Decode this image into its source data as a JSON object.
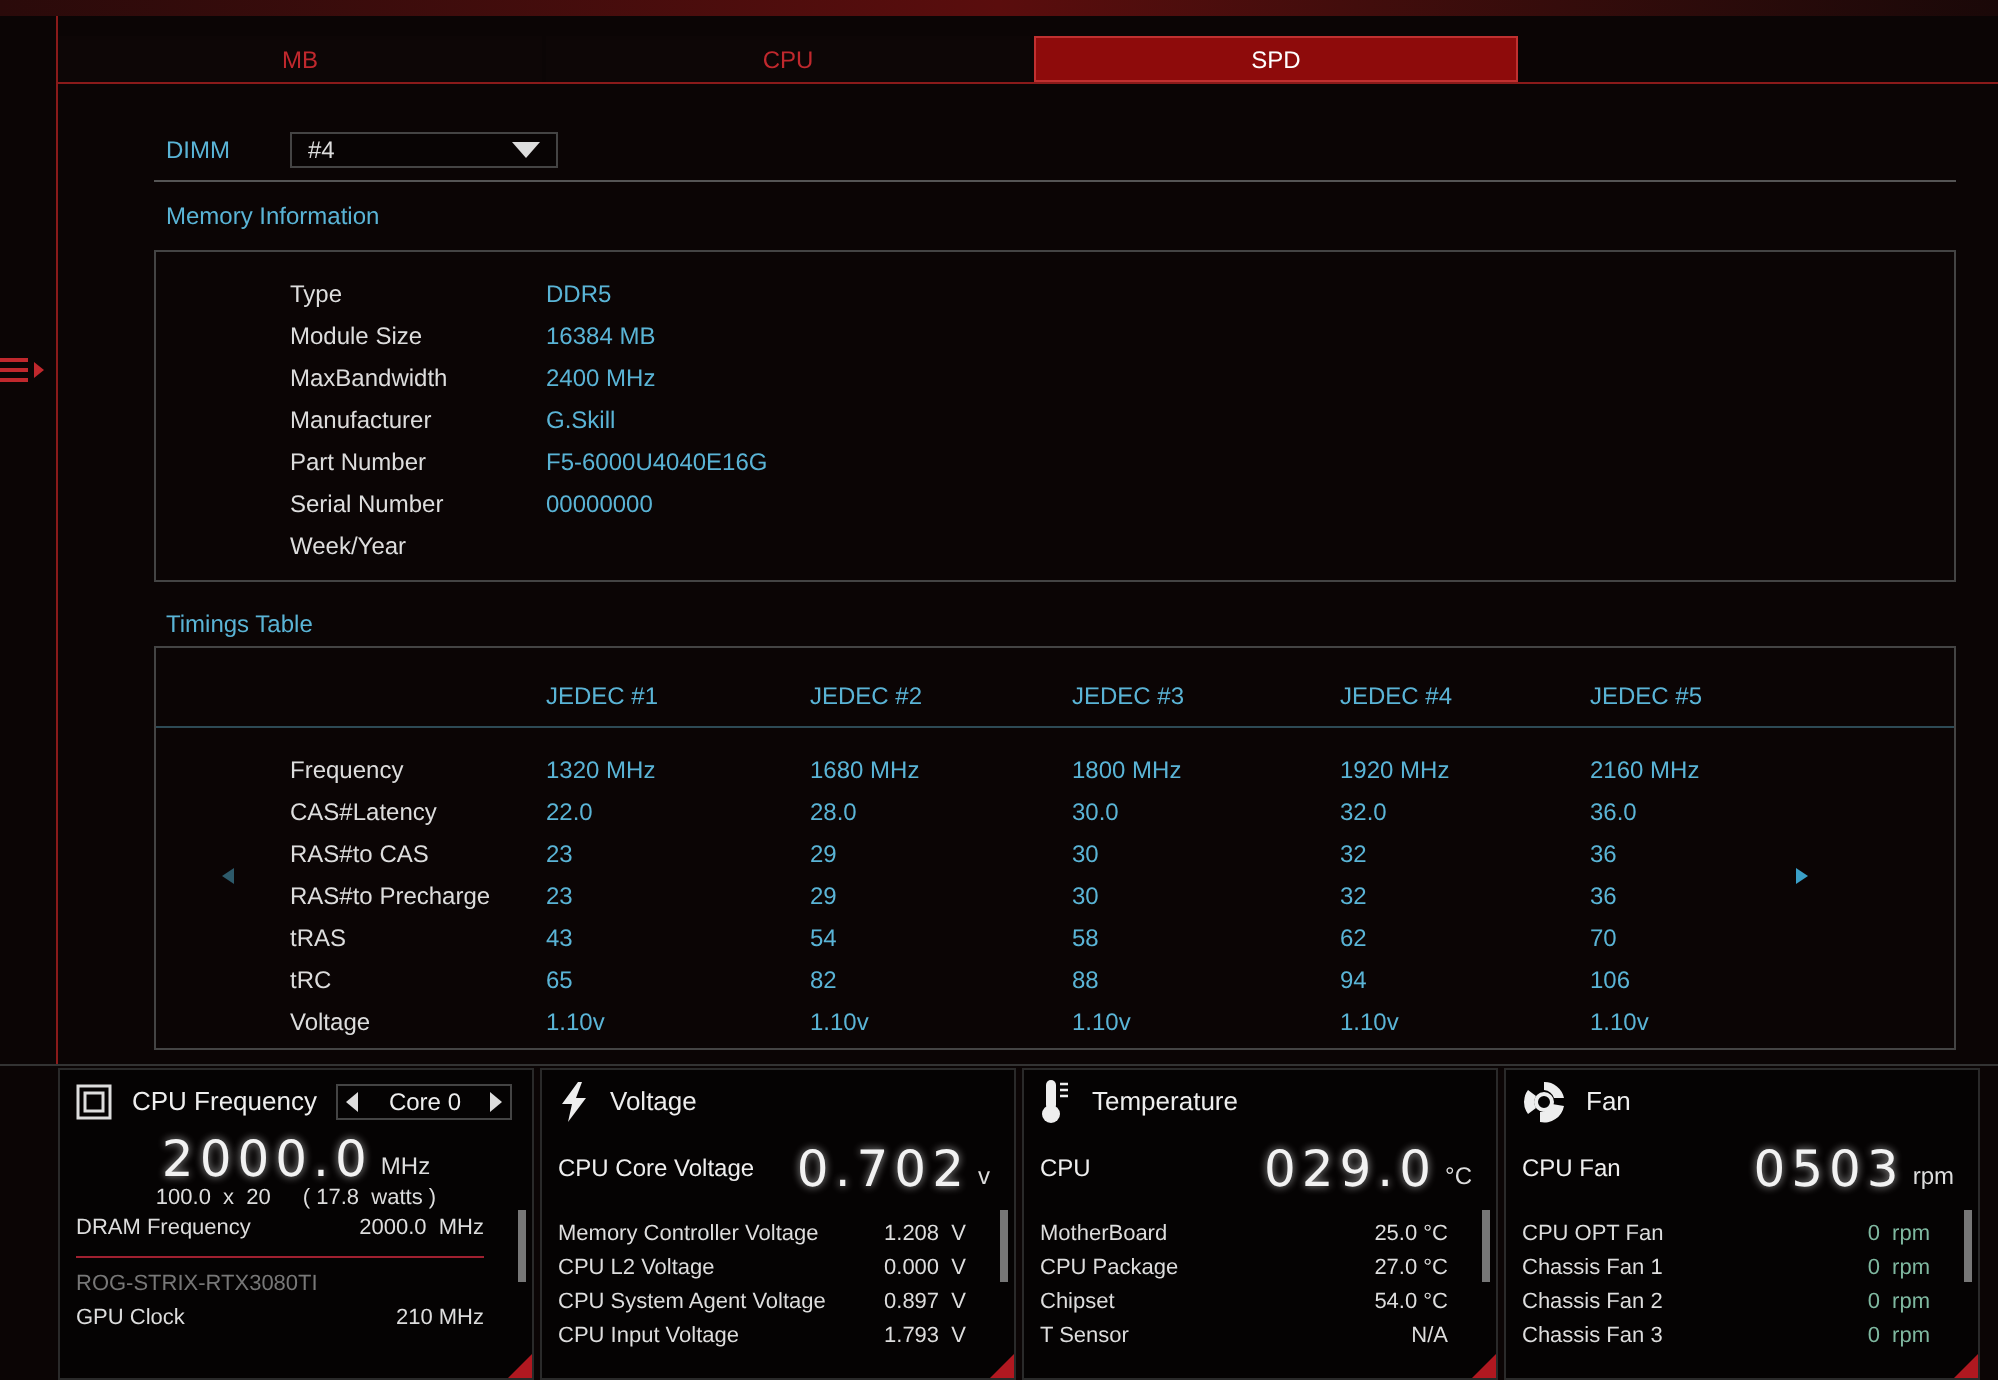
{
  "tabs": [
    {
      "label": "MB",
      "selected": false
    },
    {
      "label": "CPU",
      "selected": false
    },
    {
      "label": "SPD",
      "selected": true
    }
  ],
  "dimm": {
    "label": "DIMM",
    "value": "#4"
  },
  "memory_information": {
    "title": "Memory Information",
    "fields": [
      {
        "label": "Type",
        "value": "DDR5"
      },
      {
        "label": "Module Size",
        "value": "16384 MB"
      },
      {
        "label": "MaxBandwidth",
        "value": "2400 MHz"
      },
      {
        "label": "Manufacturer",
        "value": "G.Skill"
      },
      {
        "label": "Part Number",
        "value": "F5-6000U4040E16G"
      },
      {
        "label": "Serial Number",
        "value": "00000000"
      },
      {
        "label": "Week/Year"
      }
    ]
  },
  "timings_table": {
    "title": "Timings Table",
    "columns": [
      "JEDEC #1",
      "JEDEC #2",
      "JEDEC #3",
      "JEDEC #4",
      "JEDEC #5"
    ],
    "rows": [
      {
        "label": "Frequency",
        "values": [
          "1320 MHz",
          "1680 MHz",
          "1800 MHz",
          "1920 MHz",
          "2160 MHz"
        ]
      },
      {
        "label": "CAS#Latency",
        "values": [
          "22.0",
          "28.0",
          "30.0",
          "32.0",
          "36.0"
        ]
      },
      {
        "label": "RAS#to CAS",
        "values": [
          "23",
          "29",
          "30",
          "32",
          "36"
        ]
      },
      {
        "label": "RAS#to Precharge",
        "values": [
          "23",
          "29",
          "30",
          "32",
          "36"
        ]
      },
      {
        "label": "tRAS",
        "values": [
          "43",
          "54",
          "58",
          "62",
          "70"
        ]
      },
      {
        "label": "tRC",
        "values": [
          "65",
          "82",
          "88",
          "94",
          "106"
        ]
      },
      {
        "label": "Voltage",
        "values": [
          "1.10v",
          "1.10v",
          "1.10v",
          "1.10v",
          "1.10v"
        ]
      }
    ]
  },
  "monitors": [
    {
      "kind": "cpu_frequency",
      "title": "CPU Frequency",
      "selector": "Core 0",
      "main_value": "2000.0",
      "unit": "MHz",
      "ratio": "100.0  x  20",
      "power": "( 17.8  watts )",
      "rows": [
        {
          "label": "DRAM Frequency",
          "value": "2000.0  MHz"
        }
      ],
      "gpu_name": "ROG-STRIX-RTX3080TI",
      "gpu_rows": [
        {
          "label": "GPU Clock",
          "value": "210 MHz"
        }
      ]
    },
    {
      "kind": "voltage",
      "title": "Voltage",
      "main_label": "CPU Core Voltage",
      "main_value": "0.702",
      "unit": "v",
      "rows": [
        {
          "label": "Memory Controller Voltage",
          "value": "1.208  V"
        },
        {
          "label": "CPU L2 Voltage",
          "value": "0.000  V"
        },
        {
          "label": "CPU System Agent Voltage",
          "value": "0.897  V"
        },
        {
          "label": "CPU Input Voltage",
          "value": "1.793  V"
        }
      ]
    },
    {
      "kind": "temperature",
      "title": "Temperature",
      "main_label": "CPU",
      "main_value": "029.0",
      "unit": "°C",
      "rows": [
        {
          "label": "MotherBoard",
          "value": "25.0 °C"
        },
        {
          "label": "CPU Package",
          "value": "27.0 °C"
        },
        {
          "label": "Chipset",
          "value": "54.0 °C"
        },
        {
          "label": "T Sensor",
          "value": "N/A"
        }
      ]
    },
    {
      "kind": "fan",
      "title": "Fan",
      "main_label": "CPU Fan",
      "main_value": "0503",
      "unit": "rpm",
      "rows": [
        {
          "label": "CPU OPT Fan",
          "value": "0  rpm"
        },
        {
          "label": "Chassis Fan 1",
          "value": "0  rpm"
        },
        {
          "label": "Chassis Fan 2",
          "value": "0  rpm"
        },
        {
          "label": "Chassis Fan 3",
          "value": "0  rpm"
        }
      ]
    }
  ]
}
